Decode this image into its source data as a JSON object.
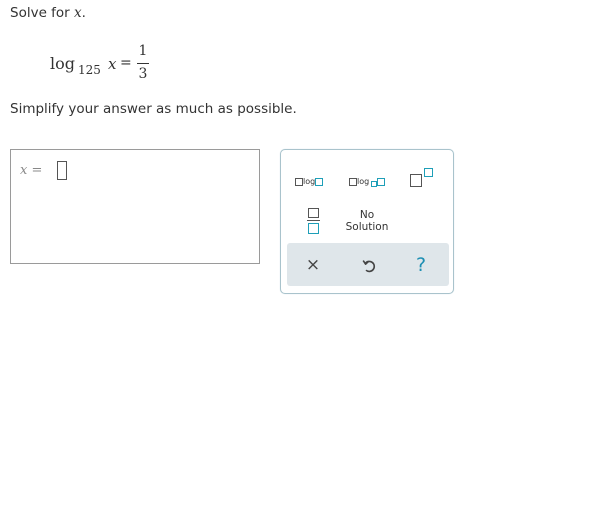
{
  "prompt": {
    "text": "Solve for ",
    "variable": "x",
    "suffix": "."
  },
  "equation": {
    "func": "log",
    "base": "125",
    "argument": "x",
    "equals": "=",
    "numerator": "1",
    "denominator": "3"
  },
  "instruction": "Simplify your answer as much as possible.",
  "answer": {
    "variable": "x",
    "equals": "=",
    "value": ""
  },
  "palette": {
    "log_label": "log",
    "logn_label": "log",
    "no_solution_line1": "No",
    "no_solution_line2": "Solution",
    "clear_symbol": "×",
    "help_symbol": "?",
    "icons": {
      "log": "log-template-icon",
      "logn": "log-base-template-icon",
      "exponent": "exponent-template-icon",
      "fraction": "fraction-template-icon",
      "clear": "close-icon",
      "undo": "undo-icon",
      "help": "help-icon"
    }
  },
  "colors": {
    "accent": "#1e9fb8",
    "help": "#1e8fb3",
    "action_bar": "#dfe6ea",
    "text": "#333333"
  }
}
